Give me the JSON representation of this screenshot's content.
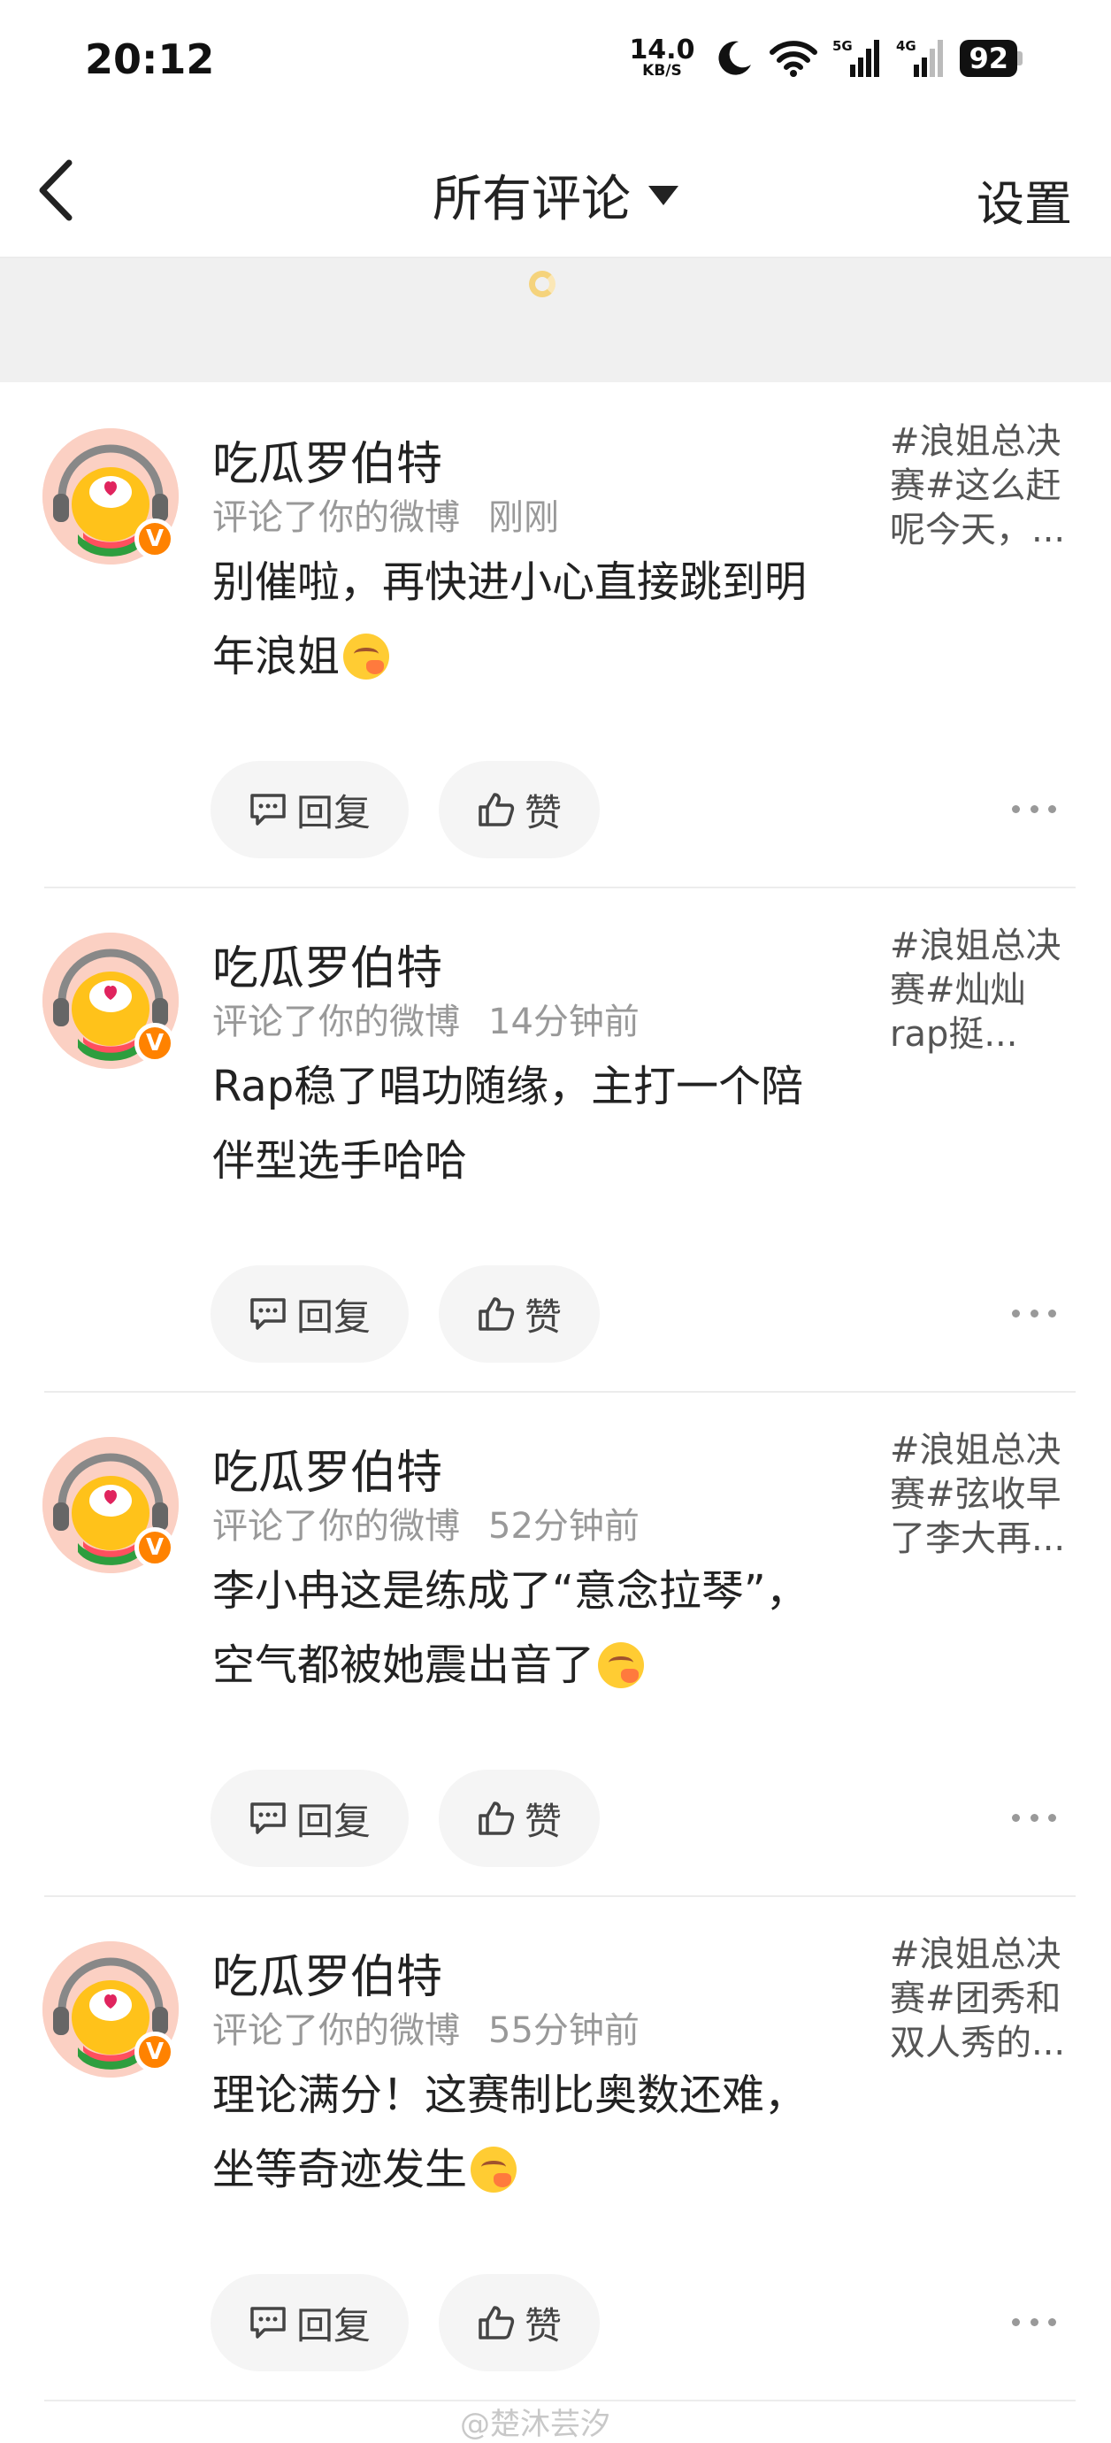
{
  "status_bar": {
    "time": "20:12",
    "net_speed_value": "14.0",
    "net_speed_unit": "KB/S",
    "battery": "92",
    "icons": [
      "moon-icon",
      "wifi-icon",
      "signal-5g-icon",
      "signal-4g-icon",
      "battery-icon"
    ]
  },
  "nav": {
    "title": "所有评论",
    "settings": "设置"
  },
  "comments": [
    {
      "username": "吃瓜罗伯特",
      "action": "评论了你的微博",
      "time": "刚刚",
      "text": "别催啦，再快进小心直接跳到明年浪姐",
      "excerpt": "#浪姐总决赛#这么赶呢今天，...",
      "reply_label": "回复",
      "like_label": "赞"
    },
    {
      "username": "吃瓜罗伯特",
      "action": "评论了你的微博",
      "time": "14分钟前",
      "text": "Rap稳了唱功随缘，主打一个陪伴型选手哈哈",
      "excerpt": "#浪姐总决赛#灿灿rap挺...",
      "reply_label": "回复",
      "like_label": "赞"
    },
    {
      "username": "吃瓜罗伯特",
      "action": "评论了你的微博",
      "time": "52分钟前",
      "text": "李小冉这是练成了“意念拉琴”，空气都被她震出音了",
      "excerpt": "#浪姐总决赛#弦收早了李大再...",
      "reply_label": "回复",
      "like_label": "赞"
    },
    {
      "username": "吃瓜罗伯特",
      "action": "评论了你的微博",
      "time": "55分钟前",
      "text": "理论满分！这赛制比奥数还难，坐等奇迹发生",
      "excerpt": "#浪姐总决赛#团秀和双人秀的...",
      "reply_label": "回复",
      "like_label": "赞"
    }
  ],
  "watermark": "@楚沐芸汐",
  "colors": {
    "accent": "#ff8200",
    "refresh_bg": "#f0f0f0",
    "button_bg": "#f5f5f5"
  }
}
